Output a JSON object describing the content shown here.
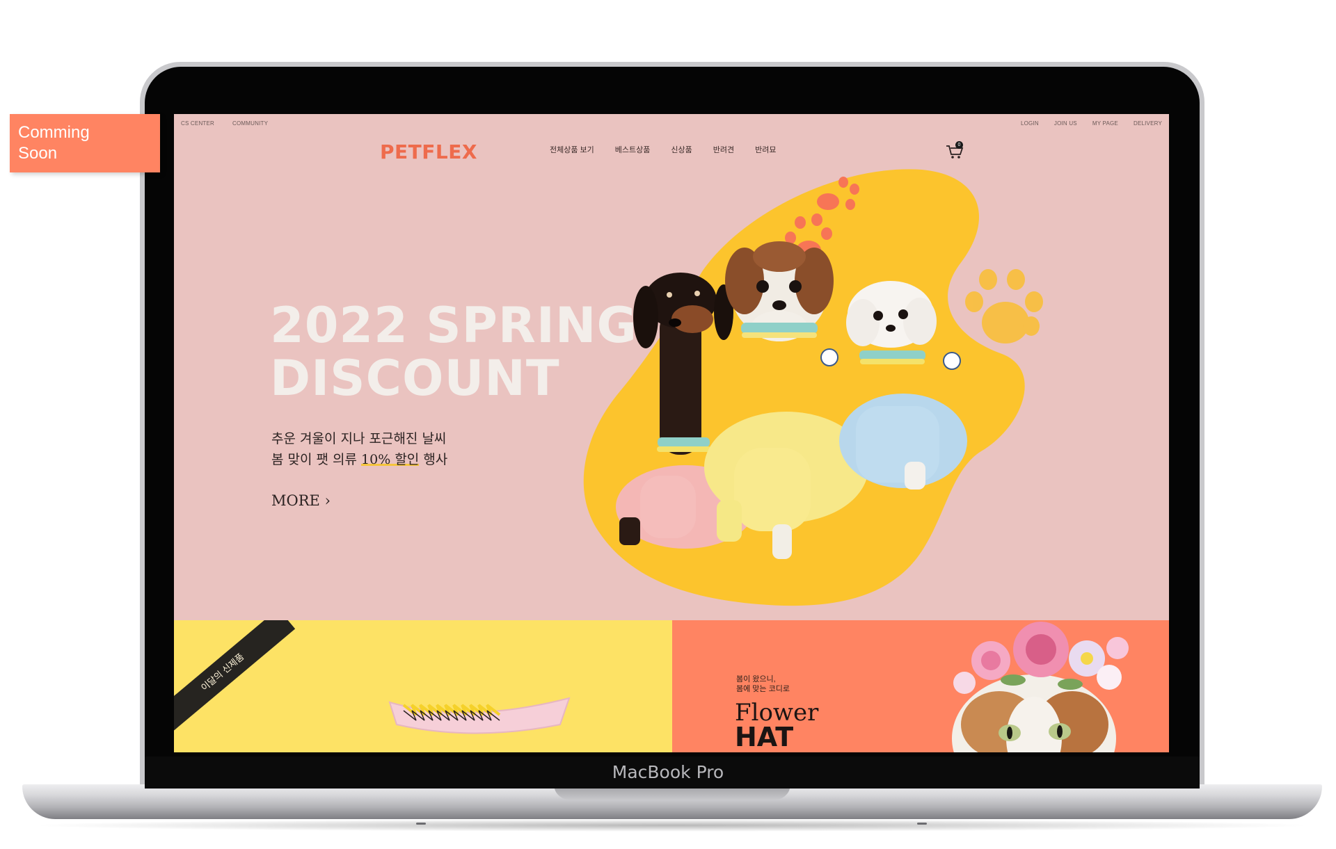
{
  "device": {
    "label": "MacBook Pro"
  },
  "badge": {
    "line1": "Comming",
    "line2": "Soon"
  },
  "util": {
    "left": [
      "CS CENTER",
      "COMMUNITY"
    ],
    "right": [
      "LOGIN",
      "JOIN US",
      "MY PAGE",
      "DELIVERY"
    ]
  },
  "header": {
    "logo": "PETFLEX",
    "nav": [
      "전체상품 보기",
      "베스트상품",
      "신상품",
      "반려견",
      "반려묘"
    ],
    "cart_count": "0"
  },
  "hero": {
    "title_line1": "2022 SPRING",
    "title_line2": "DISCOUNT",
    "sub_line1": "추운 겨울이 지나 포근해진 날씨",
    "sub_line2_pre": "봄 맞이 팻 의류 ",
    "sub_line2_hl": "10% 할인",
    "sub_line2_post": " 행사",
    "more": "MORE"
  },
  "banners": {
    "new_ribbon": "이달의 신제품",
    "flower_small_1": "봄이 왔으니,",
    "flower_small_2": "봄에 맞는 코디로",
    "flower_title": "Flower",
    "flower_hat": "HAT"
  },
  "colors": {
    "hero_bg": "#eac3c0",
    "accent_orange": "#ff8462",
    "accent_yellow": "#fde265",
    "blob_yellow": "#fcc42d",
    "logo": "#ee6b4c"
  }
}
